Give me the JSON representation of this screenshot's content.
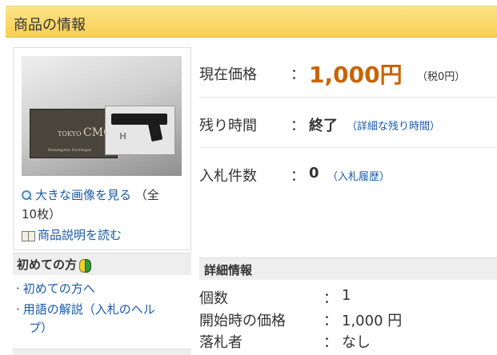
{
  "header": {
    "title": "商品の情報"
  },
  "image_panel": {
    "view_large_link": "大きな画像を見る",
    "image_count_line1": "（全",
    "image_count_line2": "10枚）",
    "description_link": "商品説明を読む",
    "photo_text": {
      "brand_small": "TOKYO",
      "brand": "CMC",
      "model": "Remington Derringer"
    }
  },
  "current_price": {
    "label": "現在価格",
    "colon": "：",
    "value": "1,000円",
    "tax": "（税0円）"
  },
  "time_left": {
    "label": "残り時間",
    "colon": "：",
    "value": "終了",
    "link": "（詳細な残り時間）"
  },
  "bids": {
    "label": "入札件数",
    "colon": "：",
    "value": "0",
    "link": "（入札履歴）"
  },
  "beginner": {
    "title": "初めての方",
    "items": [
      {
        "lines": [
          "初めての方へ"
        ]
      },
      {
        "lines": [
          "用語の解説（入札のヘル",
          "プ）"
        ]
      }
    ]
  },
  "details": {
    "title": "詳細情報",
    "rows": [
      {
        "key": "個数",
        "colon": "：",
        "value": "1"
      },
      {
        "key": "開始時の価格",
        "colon": "：",
        "value": "1,000 円"
      },
      {
        "key": "落札者",
        "colon": "：",
        "value": "なし"
      }
    ]
  },
  "colors": {
    "header_bg": "#f8cf52",
    "price": "#c86400",
    "link": "#1a5aa8"
  }
}
